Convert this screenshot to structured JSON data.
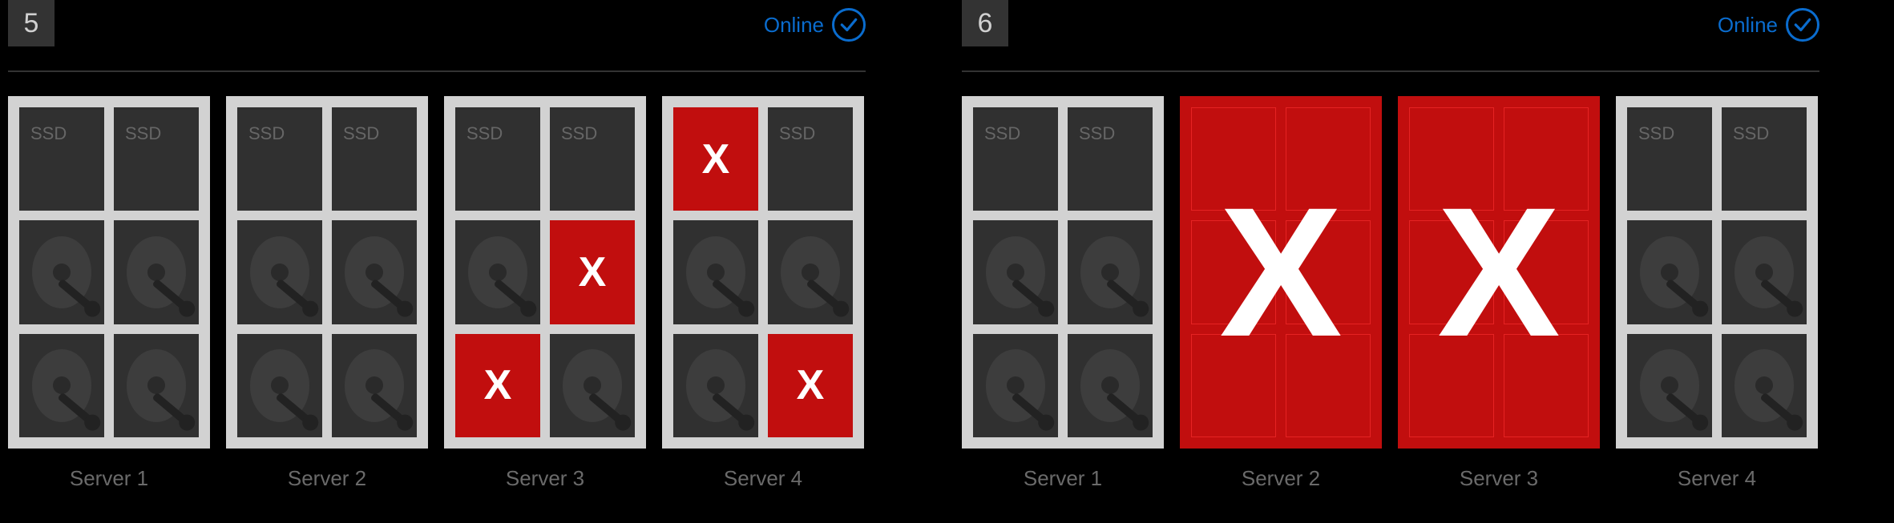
{
  "panels": [
    {
      "step": "5",
      "status_label": "Online",
      "servers": [
        {
          "label": "Server 1",
          "failed": false,
          "drives": [
            {
              "type": "ssd",
              "failed": false
            },
            {
              "type": "ssd",
              "failed": false
            },
            {
              "type": "hdd",
              "failed": false
            },
            {
              "type": "hdd",
              "failed": false
            },
            {
              "type": "hdd",
              "failed": false
            },
            {
              "type": "hdd",
              "failed": false
            }
          ]
        },
        {
          "label": "Server 2",
          "failed": false,
          "drives": [
            {
              "type": "ssd",
              "failed": false
            },
            {
              "type": "ssd",
              "failed": false
            },
            {
              "type": "hdd",
              "failed": false
            },
            {
              "type": "hdd",
              "failed": false
            },
            {
              "type": "hdd",
              "failed": false
            },
            {
              "type": "hdd",
              "failed": false
            }
          ]
        },
        {
          "label": "Server 3",
          "failed": false,
          "drives": [
            {
              "type": "ssd",
              "failed": false
            },
            {
              "type": "ssd",
              "failed": false
            },
            {
              "type": "hdd",
              "failed": false
            },
            {
              "type": "hdd",
              "failed": true
            },
            {
              "type": "hdd",
              "failed": true
            },
            {
              "type": "hdd",
              "failed": false
            }
          ]
        },
        {
          "label": "Server 4",
          "failed": false,
          "drives": [
            {
              "type": "ssd",
              "failed": true
            },
            {
              "type": "ssd",
              "failed": false
            },
            {
              "type": "hdd",
              "failed": false
            },
            {
              "type": "hdd",
              "failed": false
            },
            {
              "type": "hdd",
              "failed": false
            },
            {
              "type": "hdd",
              "failed": true
            }
          ]
        }
      ]
    },
    {
      "step": "6",
      "status_label": "Online",
      "servers": [
        {
          "label": "Server 1",
          "failed": false,
          "drives": [
            {
              "type": "ssd",
              "failed": false
            },
            {
              "type": "ssd",
              "failed": false
            },
            {
              "type": "hdd",
              "failed": false
            },
            {
              "type": "hdd",
              "failed": false
            },
            {
              "type": "hdd",
              "failed": false
            },
            {
              "type": "hdd",
              "failed": false
            }
          ]
        },
        {
          "label": "Server 2",
          "failed": true,
          "drives": [
            {
              "type": "ghost"
            },
            {
              "type": "ghost"
            },
            {
              "type": "ghost"
            },
            {
              "type": "ghost"
            },
            {
              "type": "ghost"
            },
            {
              "type": "ghost"
            }
          ]
        },
        {
          "label": "Server 3",
          "failed": true,
          "drives": [
            {
              "type": "ghost"
            },
            {
              "type": "ghost"
            },
            {
              "type": "ghost"
            },
            {
              "type": "ghost"
            },
            {
              "type": "ghost"
            },
            {
              "type": "ghost"
            }
          ]
        },
        {
          "label": "Server 4",
          "failed": false,
          "drives": [
            {
              "type": "ssd",
              "failed": false
            },
            {
              "type": "ssd",
              "failed": false
            },
            {
              "type": "hdd",
              "failed": false
            },
            {
              "type": "hdd",
              "failed": false
            },
            {
              "type": "hdd",
              "failed": false
            },
            {
              "type": "hdd",
              "failed": false
            }
          ]
        }
      ]
    }
  ],
  "labels": {
    "ssd": "SSD",
    "fail_mark": "X"
  },
  "colors": {
    "accent": "#0a6cce",
    "fail": "#c10e0e"
  }
}
